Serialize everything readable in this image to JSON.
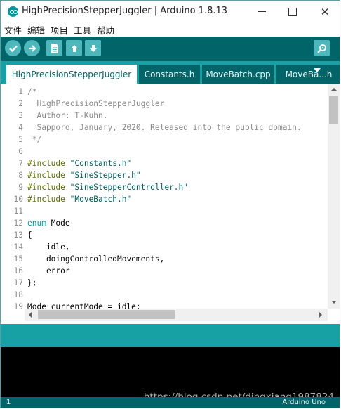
{
  "window": {
    "title": "HighPrecisionStepperJuggler | Arduino 1.8.13",
    "controls": {
      "minimize": "minimize",
      "maximize": "maximize",
      "close": "✕"
    }
  },
  "menu": [
    "文件",
    "编辑",
    "项目",
    "工具",
    "帮助"
  ],
  "toolbar": {
    "buttons": [
      {
        "name": "verify",
        "icon": "check-icon"
      },
      {
        "name": "upload",
        "icon": "arrow-right-icon"
      },
      {
        "name": "new",
        "icon": "new-file-icon"
      },
      {
        "name": "open",
        "icon": "open-up-arrow-icon"
      },
      {
        "name": "save",
        "icon": "save-down-arrow-icon"
      },
      {
        "name": "serial-monitor",
        "icon": "magnifier-icon"
      }
    ]
  },
  "tabs": [
    "HighPrecisionStepperJuggler",
    "Constants.h",
    "MoveBatch.cpp",
    "MoveBa...h"
  ],
  "editor": {
    "line_numbers": [
      "1",
      "2",
      "3",
      "4",
      "5",
      "6",
      "7",
      "8",
      "9",
      "10",
      "11",
      "12",
      "13",
      "14",
      "15",
      "16",
      "17",
      "18",
      "19"
    ],
    "lines": [
      [
        {
          "t": "/*",
          "c": "comment"
        }
      ],
      [
        {
          "t": "  HighPrecisionStepperJuggler",
          "c": "comment"
        }
      ],
      [
        {
          "t": "  Author: T-Kuhn.",
          "c": "comment"
        }
      ],
      [
        {
          "t": "  Sapporo, January, 2020. Released into the public domain.",
          "c": "comment"
        }
      ],
      [
        {
          "t": " */",
          "c": "comment"
        }
      ],
      [
        {
          "t": "",
          "c": "plain"
        }
      ],
      [
        {
          "t": "#include ",
          "c": "kw"
        },
        {
          "t": "\"Constants.h\"",
          "c": "str"
        }
      ],
      [
        {
          "t": "#include ",
          "c": "kw"
        },
        {
          "t": "\"SineStepper.h\"",
          "c": "str"
        }
      ],
      [
        {
          "t": "#include ",
          "c": "kw"
        },
        {
          "t": "\"SineStepperController.h\"",
          "c": "str"
        }
      ],
      [
        {
          "t": "#include ",
          "c": "kw"
        },
        {
          "t": "\"MoveBatch.h\"",
          "c": "str"
        }
      ],
      [
        {
          "t": "",
          "c": "plain"
        }
      ],
      [
        {
          "t": "enum",
          "c": "enum"
        },
        {
          "t": " Mode",
          "c": "plain"
        }
      ],
      [
        {
          "t": "{",
          "c": "plain"
        }
      ],
      [
        {
          "t": "    idle,",
          "c": "plain"
        }
      ],
      [
        {
          "t": "    doingControlledMovements,",
          "c": "plain"
        }
      ],
      [
        {
          "t": "    error",
          "c": "plain"
        }
      ],
      [
        {
          "t": "};",
          "c": "plain"
        }
      ],
      [
        {
          "t": "",
          "c": "plain"
        }
      ],
      [
        {
          "t": "Mode currentMode = idle;",
          "c": "plain"
        }
      ]
    ]
  },
  "watermark": "https://blog.csdn.net/dingxiang1987824",
  "status": {
    "line": "1",
    "board": "Arduino Uno"
  },
  "colors": {
    "toolbar": "#006468",
    "tabbar": "#17a1a5",
    "button": "#4db7bb",
    "comment": "#8a8a8a",
    "keyword": "#5e6d03",
    "string": "#005c5f",
    "enum": "#00979c"
  }
}
